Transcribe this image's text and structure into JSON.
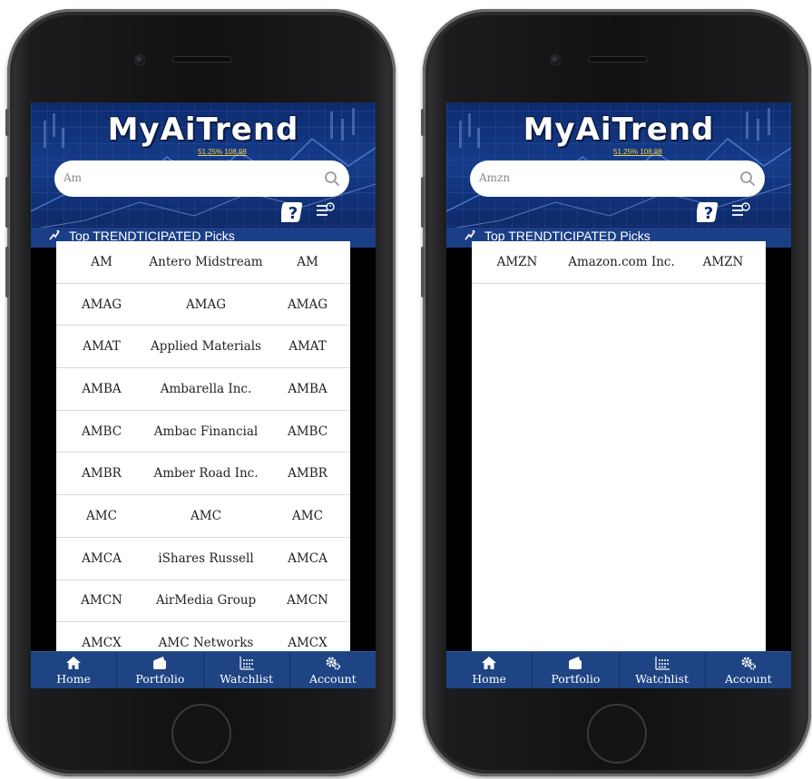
{
  "app": {
    "logo": "MyAiTrend",
    "logo_sub": "51.25% 108.98",
    "picks_label": "Top TRENDTICIPATED Picks"
  },
  "screens": [
    {
      "search": {
        "value": "Am"
      },
      "results": [
        {
          "symbol": "AM",
          "name": "Antero Midstream",
          "ticker": "AM"
        },
        {
          "symbol": "AMAG",
          "name": "AMAG",
          "ticker": "AMAG"
        },
        {
          "symbol": "AMAT",
          "name": "Applied Materials",
          "ticker": "AMAT"
        },
        {
          "symbol": "AMBA",
          "name": "Ambarella Inc.",
          "ticker": "AMBA"
        },
        {
          "symbol": "AMBC",
          "name": "Ambac Financial",
          "ticker": "AMBC"
        },
        {
          "symbol": "AMBR",
          "name": "Amber Road Inc.",
          "ticker": "AMBR"
        },
        {
          "symbol": "AMC",
          "name": "AMC",
          "ticker": "AMC"
        },
        {
          "symbol": "AMCA",
          "name": "iShares Russell",
          "ticker": "AMCA"
        },
        {
          "symbol": "AMCN",
          "name": "AirMedia Group",
          "ticker": "AMCN"
        },
        {
          "symbol": "AMCX",
          "name": "AMC Networks",
          "ticker": "AMCX"
        }
      ]
    },
    {
      "search": {
        "value": "Amzn"
      },
      "results": [
        {
          "symbol": "AMZN",
          "name": "Amazon.com Inc.",
          "ticker": "AMZN"
        }
      ]
    }
  ],
  "tabs": [
    {
      "label": "Home",
      "icon": "home-icon"
    },
    {
      "label": "Portfolio",
      "icon": "portfolio-icon"
    },
    {
      "label": "Watchlist",
      "icon": "watchlist-icon"
    },
    {
      "label": "Account",
      "icon": "account-gears-icon"
    }
  ],
  "colors": {
    "header_blue": "#163c8a",
    "tabbar_blue": "#1f4484",
    "logo_accent": "#f4d03f"
  }
}
